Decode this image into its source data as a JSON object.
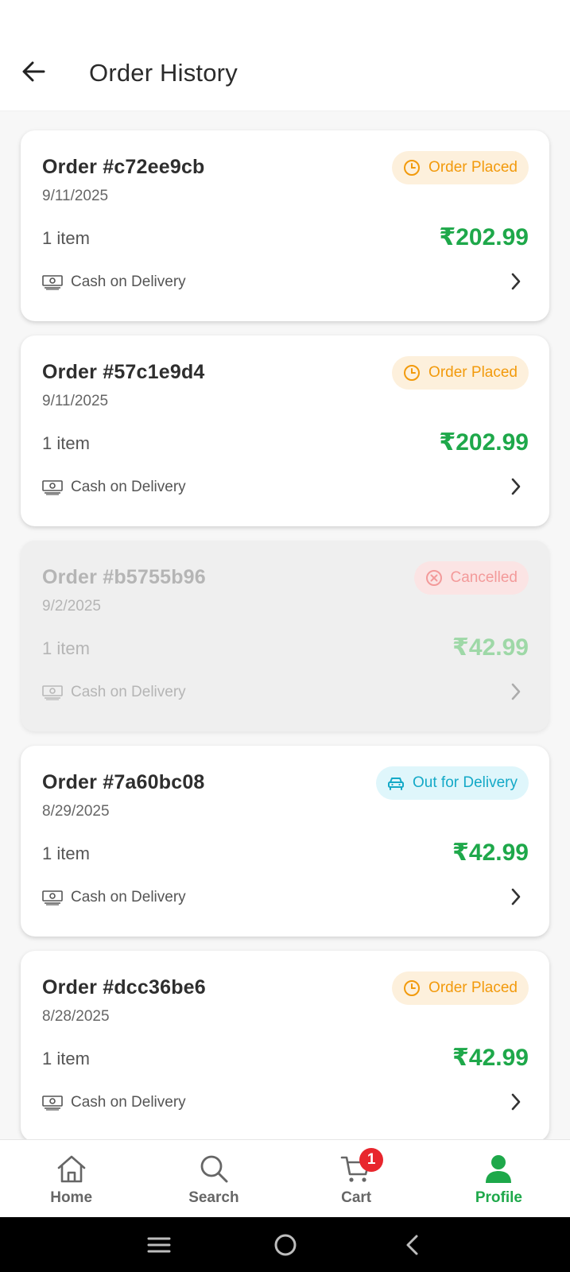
{
  "header": {
    "title": "Order History",
    "back_icon": "arrow-left-icon"
  },
  "orders": [
    {
      "id": "Order #c72ee9cb",
      "date": "9/11/2025",
      "status": "Order Placed",
      "status_icon": "clock-icon",
      "items": "1 item",
      "price": "₹202.99",
      "payment": "Cash on Delivery"
    },
    {
      "id": "Order #57c1e9d4",
      "date": "9/11/2025",
      "status": "Order Placed",
      "status_icon": "clock-icon",
      "items": "1 item",
      "price": "₹202.99",
      "payment": "Cash on Delivery"
    },
    {
      "id": "Order #b5755b96",
      "date": "9/2/2025",
      "status": "Cancelled",
      "status_icon": "x-circle-icon",
      "items": "1 item",
      "price": "₹42.99",
      "payment": "Cash on Delivery"
    },
    {
      "id": "Order #7a60bc08",
      "date": "8/29/2025",
      "status": "Out for Delivery",
      "status_icon": "car-icon",
      "items": "1 item",
      "price": "₹42.99",
      "payment": "Cash on Delivery"
    },
    {
      "id": "Order #dcc36be6",
      "date": "8/28/2025",
      "status": "Order Placed",
      "status_icon": "clock-icon",
      "items": "1 item",
      "price": "₹42.99",
      "payment": "Cash on Delivery"
    }
  ],
  "bottom_nav": {
    "items": [
      {
        "label": "Home",
        "icon": "home-icon"
      },
      {
        "label": "Search",
        "icon": "search-icon"
      },
      {
        "label": "Cart",
        "icon": "cart-icon",
        "badge": "1"
      },
      {
        "label": "Profile",
        "icon": "profile-icon",
        "active": true
      }
    ]
  },
  "colors": {
    "accent_green": "#1ea84a",
    "placed_orange": "#f29a0c",
    "cancelled_red": "#f39a9a",
    "delivery_cyan": "#14a9c7",
    "cart_badge_red": "#e8262d"
  }
}
